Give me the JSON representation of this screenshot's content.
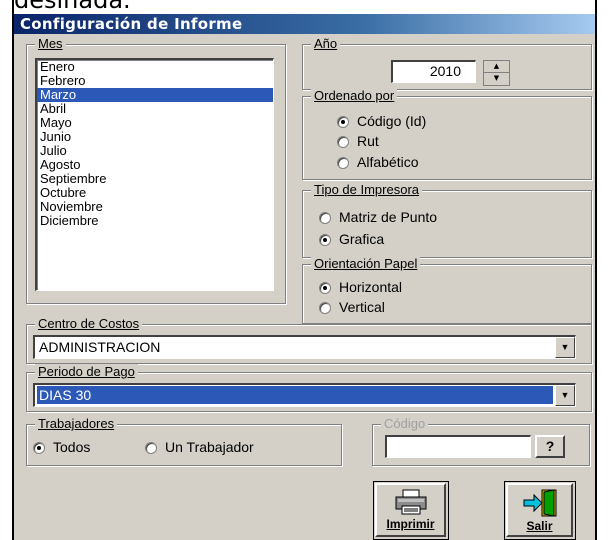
{
  "background_caption": "desinada.",
  "window": {
    "title": "Configuración de Informe"
  },
  "mes": {
    "legend": "Mes",
    "months": [
      "Enero",
      "Febrero",
      "Marzo",
      "Abril",
      "Mayo",
      "Junio",
      "Julio",
      "Agosto",
      "Septiembre",
      "Octubre",
      "Noviembre",
      "Diciembre"
    ],
    "selected": "Marzo"
  },
  "anio": {
    "legend": "Año",
    "value": "2010"
  },
  "ordenado": {
    "legend": "Ordenado por",
    "options": [
      {
        "label": "Código (Id)",
        "selected": true
      },
      {
        "label": "Rut",
        "selected": false
      },
      {
        "label": "Alfabético",
        "selected": false
      }
    ]
  },
  "impresora": {
    "legend": "Tipo de Impresora",
    "options": [
      {
        "label": "Matriz de Punto",
        "selected": false
      },
      {
        "label": "Grafica",
        "selected": true
      }
    ]
  },
  "orientacion": {
    "legend": "Orientación Papel",
    "options": [
      {
        "label": "Horizontal",
        "selected": true
      },
      {
        "label": "Vertical",
        "selected": false
      }
    ]
  },
  "centro": {
    "legend": "Centro de Costos",
    "value": "ADMINISTRACION"
  },
  "periodo": {
    "legend": "Periodo de Pago",
    "value": "DIAS 30"
  },
  "trabajadores": {
    "legend": "Trabajadores",
    "options": [
      {
        "label": "Todos",
        "selected": true
      },
      {
        "label": "Un Trabajador",
        "selected": false
      }
    ]
  },
  "codigo": {
    "legend": "Código",
    "value": "",
    "button": "?"
  },
  "buttons": {
    "print": "Imprimir",
    "exit": "Salir"
  }
}
